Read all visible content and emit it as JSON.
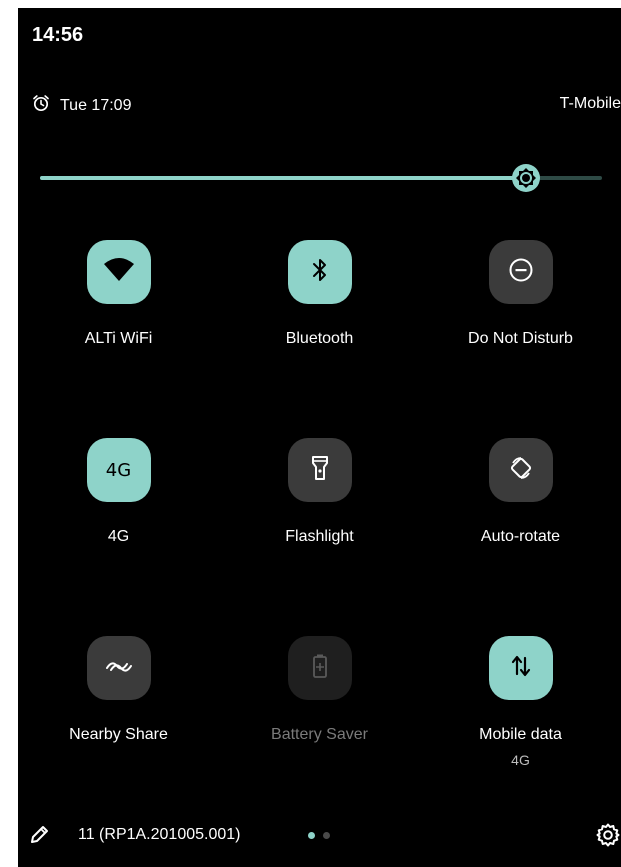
{
  "status_bar": {
    "time": "14:56"
  },
  "header": {
    "alarm_text": "Tue 17:09",
    "carrier": "T-Mobile"
  },
  "brightness": {
    "level": 0.865
  },
  "tiles": [
    {
      "label": "ALTi WiFi",
      "state": "on",
      "icon": "wifi-icon"
    },
    {
      "label": "Bluetooth",
      "state": "on",
      "icon": "bluetooth-icon"
    },
    {
      "label": "Do Not Disturb",
      "state": "off",
      "icon": "do-not-disturb-icon"
    },
    {
      "label": "4G",
      "state": "on",
      "icon": "4g-icon",
      "icon_text": "4G"
    },
    {
      "label": "Flashlight",
      "state": "off",
      "icon": "flashlight-icon"
    },
    {
      "label": "Auto-rotate",
      "state": "off",
      "icon": "auto-rotate-icon"
    },
    {
      "label": "Nearby Share",
      "state": "off",
      "icon": "nearby-share-icon"
    },
    {
      "label": "Battery Saver",
      "state": "unavailable",
      "icon": "battery-saver-icon"
    },
    {
      "label": "Mobile data",
      "sublabel": "4G",
      "state": "on",
      "icon": "mobile-data-icon"
    }
  ],
  "footer": {
    "build": "11 (RP1A.201005.001)",
    "page_count": 2,
    "active_page": 1
  },
  "colors": {
    "accent": "#8ed3c9",
    "tile_off": "#3b3b3b",
    "background": "#000000"
  }
}
